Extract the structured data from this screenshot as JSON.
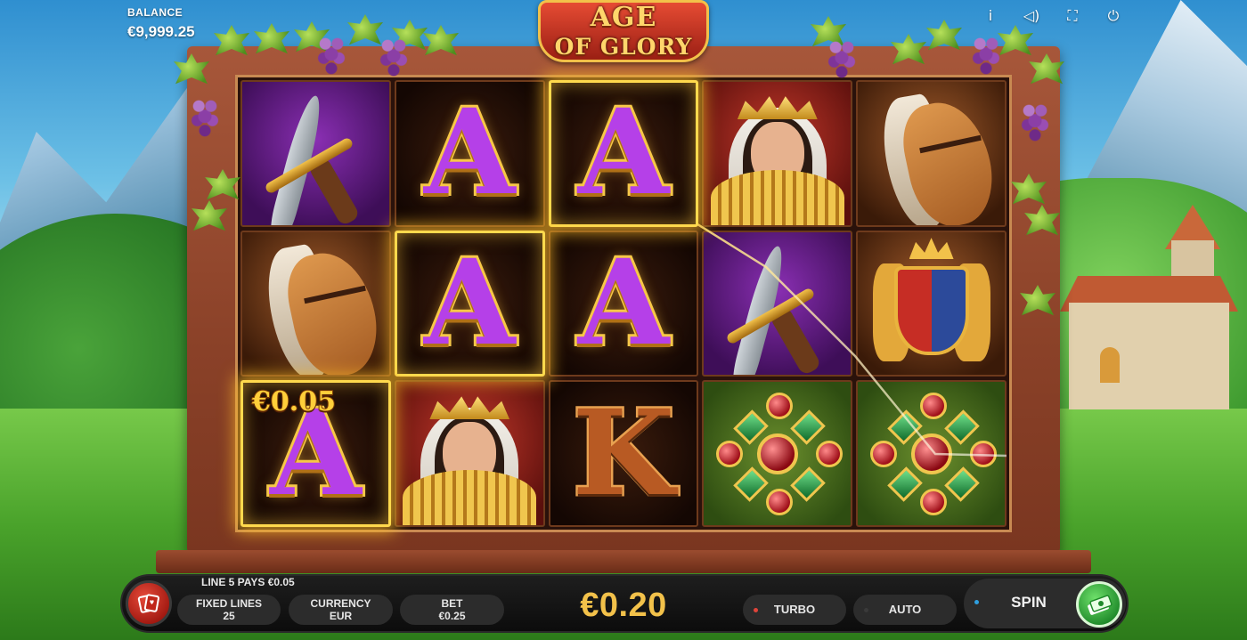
{
  "game": {
    "logo_line1": "AGE",
    "logo_line2": "OF GLORY"
  },
  "hud": {
    "balance_label": "BALANCE",
    "balance_value": "€9,999.25",
    "icons": [
      "info-icon",
      "sound-icon",
      "fullscreen-icon",
      "power-icon"
    ],
    "info_glyph": "i",
    "sound_glyph": "◁)",
    "fullscreen_glyph": "⛶",
    "power_glyph": "⏻"
  },
  "reels": {
    "columns": 5,
    "rows": 3,
    "grid": [
      [
        "sword",
        "A",
        "A",
        "queen",
        "horse"
      ],
      [
        "horse",
        "A",
        "A",
        "sword",
        "crest"
      ],
      [
        "A",
        "queen",
        "K",
        "cross",
        "cross"
      ]
    ],
    "winning_cells": [
      "r1c2",
      "r2c1",
      "r3c0"
    ],
    "win_amount_label": "€0.05",
    "letter_a": "A",
    "letter_k": "K"
  },
  "controls": {
    "line_message": "LINE 5 PAYS €0.05",
    "fixed_lines_label": "FIXED LINES",
    "fixed_lines_value": "25",
    "currency_label": "CURRENCY",
    "currency_value": "EUR",
    "bet_label": "BET",
    "bet_value": "€0.25",
    "total_stake": "€0.20",
    "turbo_label": "TURBO",
    "auto_label": "AUTO",
    "spin_label": "SPIN"
  },
  "colors": {
    "accent_gold": "#f2c14a",
    "turbo_dot": "#e0443a",
    "auto_dot": "#3a3a3a",
    "spin_dot": "#2fa0e0",
    "win_glow": "#ffd94d"
  }
}
